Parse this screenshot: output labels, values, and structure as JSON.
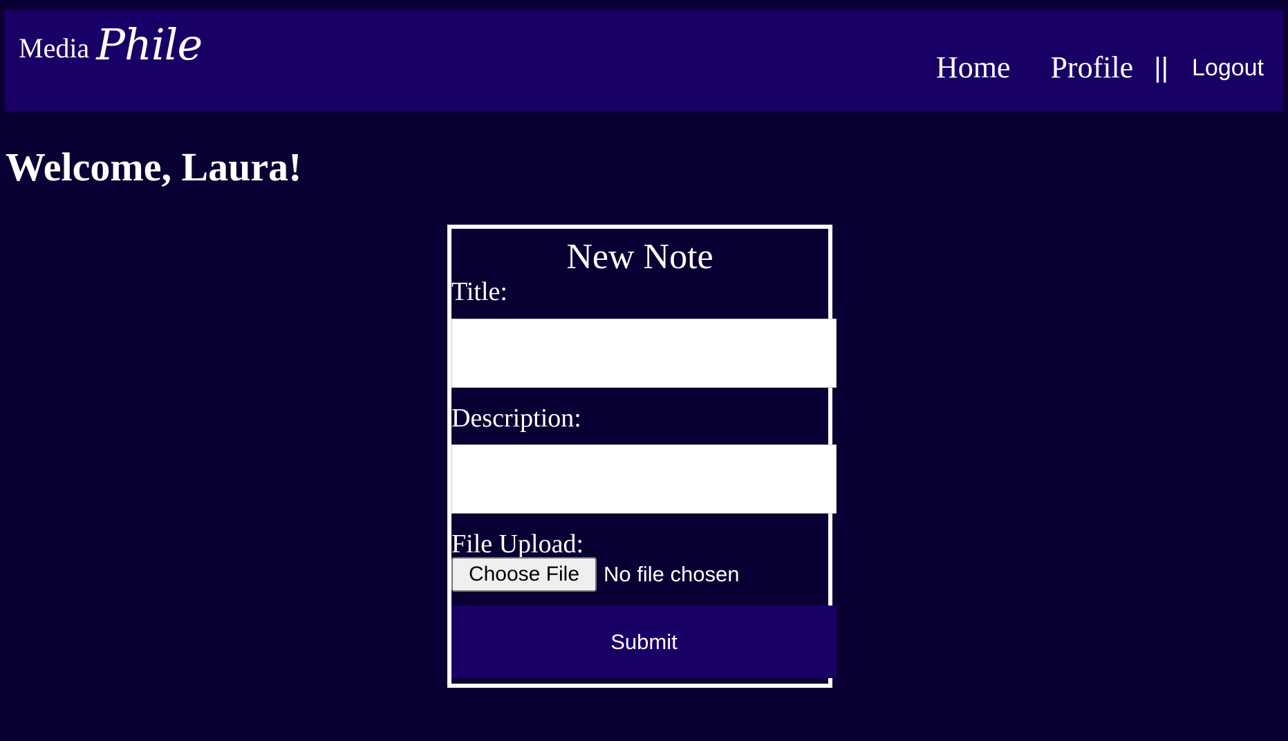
{
  "navbar": {
    "brand": {
      "word1": "Media",
      "word2": "Phile"
    },
    "links": {
      "home": "Home",
      "profile": "Profile",
      "separator": "||",
      "logout": "Logout"
    }
  },
  "main": {
    "welcome": "Welcome, Laura!"
  },
  "form": {
    "heading": "New Note",
    "title_label": "Title:",
    "title_value": "",
    "description_label": "Description:",
    "description_value": "",
    "file_label": "File Upload:",
    "file_button": "Choose File",
    "file_status": "No file chosen",
    "submit_label": "Submit"
  },
  "colors": {
    "background": "#0a0033",
    "navbar": "#1a0066",
    "submit_button": "#1a0066",
    "text": "#ffffff",
    "card_border": "#ffffff"
  }
}
